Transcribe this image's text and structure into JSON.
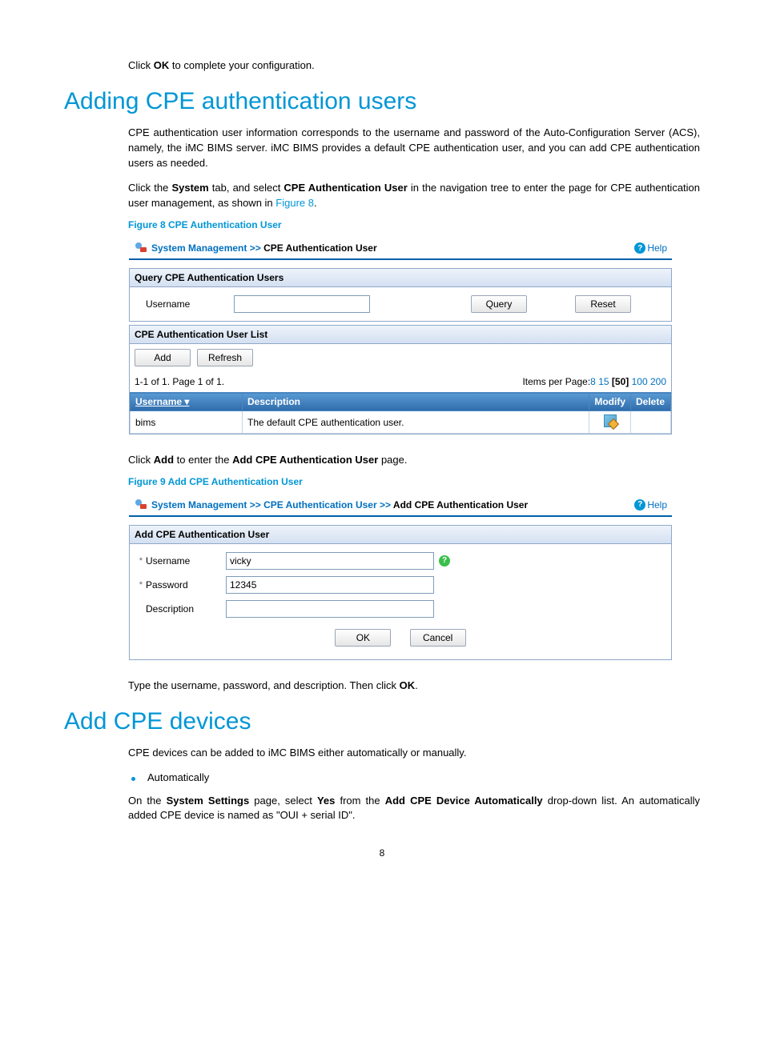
{
  "intro_line_pre": "Click ",
  "intro_line_bold": "OK",
  "intro_line_post": " to complete your configuration.",
  "h1_adding": "Adding CPE authentication users",
  "p1": "CPE authentication user information corresponds to the username and password of the Auto-Configuration Server (ACS), namely, the iMC BIMS server. iMC BIMS provides a default CPE authentication user, and you can add CPE authentication users as needed.",
  "p2_pre": "Click the ",
  "p2_b1": "System",
  "p2_mid1": " tab, and select ",
  "p2_b2": "CPE Authentication User",
  "p2_mid2": " in the navigation tree to enter the page for CPE authentication user management, as shown in ",
  "p2_link": "Figure 8",
  "p2_post": ".",
  "fig8_caption": "Figure 8 CPE Authentication User",
  "fig8": {
    "bc_root": "System Management",
    "bc_sep": ">>",
    "bc_current": "CPE Authentication User",
    "help": "Help",
    "query_header": "Query CPE Authentication Users",
    "username_label": "Username",
    "query_btn": "Query",
    "reset_btn": "Reset",
    "list_header": "CPE Authentication User List",
    "add_btn": "Add",
    "refresh_btn": "Refresh",
    "pager_left": "1-1 of 1. Page 1 of 1.",
    "pager_label": "Items per Page:",
    "pp_8": "8",
    "pp_15": "15",
    "pp_50": "[50]",
    "pp_100": "100",
    "pp_200": "200",
    "th_user": "Username",
    "th_desc": "Description",
    "th_modify": "Modify",
    "th_delete": "Delete",
    "row_user": "bims",
    "row_desc": "The default CPE authentication user."
  },
  "p3_pre": "Click ",
  "p3_b1": "Add",
  "p3_mid": " to enter the ",
  "p3_b2": "Add CPE Authentication User",
  "p3_post": " page.",
  "fig9_caption": "Figure 9 Add CPE Authentication User",
  "fig9": {
    "bc_root": "System Management",
    "bc_sep": ">>",
    "bc_l2": "CPE Authentication User",
    "bc_current": "Add CPE Authentication User",
    "help": "Help",
    "panel_header": "Add CPE Authentication User",
    "req": "*",
    "username_label": "Username",
    "username_value": "vicky",
    "password_label": "Password",
    "password_value": "12345",
    "description_label": "Description",
    "ok_btn": "OK",
    "cancel_btn": "Cancel"
  },
  "p4_pre": "Type the username, password, and description. Then click ",
  "p4_b": "OK",
  "p4_post": ".",
  "h1_add_dev": "Add CPE devices",
  "p5": "CPE devices can be added to iMC BIMS either automatically or manually.",
  "bullet1": "Automatically",
  "p6_pre": "On the ",
  "p6_b1": "System Settings",
  "p6_mid1": " page, select ",
  "p6_b2": "Yes",
  "p6_mid2": " from the ",
  "p6_b3": "Add CPE Device Automatically",
  "p6_post": " drop-down list. An automatically added CPE device is named as \"OUI + serial ID\".",
  "page_num": "8"
}
